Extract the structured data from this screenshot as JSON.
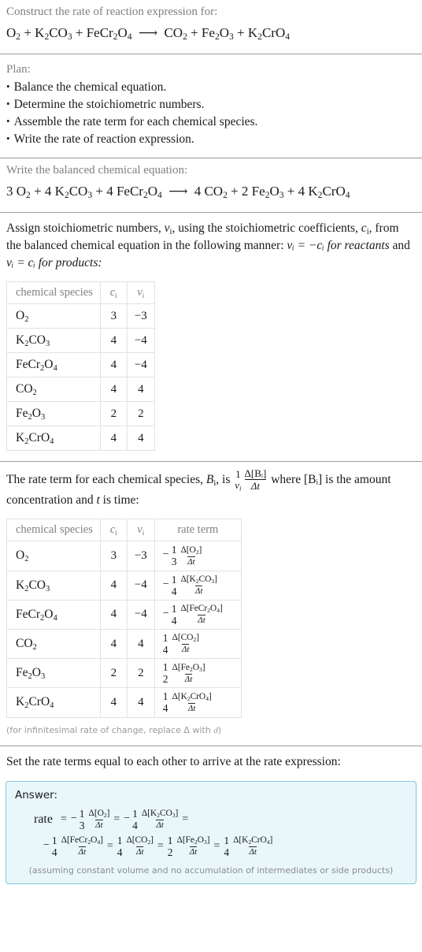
{
  "header": {
    "prompt": "Construct the rate of reaction expression for:",
    "equation": {
      "reactants": [
        {
          "formula": "O",
          "sub": "2"
        },
        {
          "formula": "K",
          "sub": "2",
          "formula2": "CO",
          "sub2": "3"
        },
        {
          "formula": "FeCr",
          "sub": "2",
          "formula2": "O",
          "sub2": "4"
        }
      ],
      "arrow": "⟶",
      "products": [
        {
          "formula": "CO",
          "sub": "2"
        },
        {
          "formula": "Fe",
          "sub": "2",
          "formula2": "O",
          "sub2": "3"
        },
        {
          "formula": "K",
          "sub": "2",
          "formula2": "CrO",
          "sub2": "4"
        }
      ]
    }
  },
  "plan": {
    "label": "Plan:",
    "steps": [
      "Balance the chemical equation.",
      "Determine the stoichiometric numbers.",
      "Assemble the rate term for each chemical species.",
      "Write the rate of reaction expression."
    ]
  },
  "balanced": {
    "label": "Write the balanced chemical equation:",
    "coefficients": {
      "O2": 3,
      "K2CO3": 4,
      "FeCr2O4": 4,
      "CO2": 4,
      "Fe2O3": 2,
      "K2CrO4": 4
    }
  },
  "assign": {
    "text_1": "Assign stoichiometric numbers, ",
    "nu_i": "ν",
    "text_2": ", using the stoichiometric coefficients, ",
    "c_i": "c",
    "text_3": ", from the balanced chemical equation in the following manner: ",
    "eq_reactants": "νᵢ = −cᵢ for reactants",
    "text_4": " and ",
    "eq_products": "νᵢ = cᵢ for products:"
  },
  "table_stoich": {
    "headers": [
      "chemical species",
      "c",
      "ν"
    ],
    "rows": [
      {
        "species": [
          {
            "t": "O"
          },
          {
            "s": "2"
          }
        ],
        "c": "3",
        "nu": "−3"
      },
      {
        "species": [
          {
            "t": "K"
          },
          {
            "s": "2"
          },
          {
            "t": "CO"
          },
          {
            "s": "3"
          }
        ],
        "c": "4",
        "nu": "−4"
      },
      {
        "species": [
          {
            "t": "FeCr"
          },
          {
            "s": "2"
          },
          {
            "t": "O"
          },
          {
            "s": "4"
          }
        ],
        "c": "4",
        "nu": "−4"
      },
      {
        "species": [
          {
            "t": "CO"
          },
          {
            "s": "2"
          }
        ],
        "c": "4",
        "nu": "4"
      },
      {
        "species": [
          {
            "t": "Fe"
          },
          {
            "s": "2"
          },
          {
            "t": "O"
          },
          {
            "s": "3"
          }
        ],
        "c": "2",
        "nu": "2"
      },
      {
        "species": [
          {
            "t": "K"
          },
          {
            "s": "2"
          },
          {
            "t": "CrO"
          },
          {
            "s": "4"
          }
        ],
        "c": "4",
        "nu": "4"
      }
    ]
  },
  "rateterm_intro": {
    "text_1": "The rate term for each chemical species, ",
    "B_i": "B",
    "text_2": ", is ",
    "frac_num": "1",
    "frac_den": "ν",
    "delta_num": "Δ[Bᵢ]",
    "delta_den": "Δt",
    "text_3": " where [Bᵢ] is the amount concentration and ",
    "t_italic": "t",
    "text_4": " is time:"
  },
  "table_rate": {
    "headers": [
      "chemical species",
      "c",
      "ν",
      "rate term"
    ],
    "rows": [
      {
        "species": [
          {
            "t": "O"
          },
          {
            "s": "2"
          }
        ],
        "c": "3",
        "nu": "−3",
        "sign": "−",
        "coef_num": "1",
        "coef_den": "3",
        "delta": [
          {
            "t": "Δ[O"
          },
          {
            "s": "2"
          },
          {
            "t": "]"
          }
        ],
        "dt": "Δt"
      },
      {
        "species": [
          {
            "t": "K"
          },
          {
            "s": "2"
          },
          {
            "t": "CO"
          },
          {
            "s": "3"
          }
        ],
        "c": "4",
        "nu": "−4",
        "sign": "−",
        "coef_num": "1",
        "coef_den": "4",
        "delta": [
          {
            "t": "Δ[K"
          },
          {
            "s": "2"
          },
          {
            "t": "CO"
          },
          {
            "s": "3"
          },
          {
            "t": "]"
          }
        ],
        "dt": "Δt"
      },
      {
        "species": [
          {
            "t": "FeCr"
          },
          {
            "s": "2"
          },
          {
            "t": "O"
          },
          {
            "s": "4"
          }
        ],
        "c": "4",
        "nu": "−4",
        "sign": "−",
        "coef_num": "1",
        "coef_den": "4",
        "delta": [
          {
            "t": "Δ[FeCr"
          },
          {
            "s": "2"
          },
          {
            "t": "O"
          },
          {
            "s": "4"
          },
          {
            "t": "]"
          }
        ],
        "dt": "Δt"
      },
      {
        "species": [
          {
            "t": "CO"
          },
          {
            "s": "2"
          }
        ],
        "c": "4",
        "nu": "4",
        "sign": "",
        "coef_num": "1",
        "coef_den": "4",
        "delta": [
          {
            "t": "Δ[CO"
          },
          {
            "s": "2"
          },
          {
            "t": "]"
          }
        ],
        "dt": "Δt"
      },
      {
        "species": [
          {
            "t": "Fe"
          },
          {
            "s": "2"
          },
          {
            "t": "O"
          },
          {
            "s": "3"
          }
        ],
        "c": "2",
        "nu": "2",
        "sign": "",
        "coef_num": "1",
        "coef_den": "2",
        "delta": [
          {
            "t": "Δ[Fe"
          },
          {
            "s": "2"
          },
          {
            "t": "O"
          },
          {
            "s": "3"
          },
          {
            "t": "]"
          }
        ],
        "dt": "Δt"
      },
      {
        "species": [
          {
            "t": "K"
          },
          {
            "s": "2"
          },
          {
            "t": "CrO"
          },
          {
            "s": "4"
          }
        ],
        "c": "4",
        "nu": "4",
        "sign": "",
        "coef_num": "1",
        "coef_den": "4",
        "delta": [
          {
            "t": "Δ[K"
          },
          {
            "s": "2"
          },
          {
            "t": "CrO"
          },
          {
            "s": "4"
          },
          {
            "t": "]"
          }
        ],
        "dt": "Δt"
      }
    ]
  },
  "infinitesimal_note": "(for infinitesimal rate of change, replace Δ with d)",
  "set_equal_label": "Set the rate terms equal to each other to arrive at the rate expression:",
  "answer": {
    "label": "Answer:",
    "rate_word": "rate",
    "equals": "=",
    "terms": [
      {
        "sign": "−",
        "num": "1",
        "den": "3",
        "delta": [
          {
            "t": "Δ[O"
          },
          {
            "s": "2"
          },
          {
            "t": "]"
          }
        ],
        "dt": "Δt"
      },
      {
        "sign": "−",
        "num": "1",
        "den": "4",
        "delta": [
          {
            "t": "Δ[K"
          },
          {
            "s": "2"
          },
          {
            "t": "CO"
          },
          {
            "s": "3"
          },
          {
            "t": "]"
          }
        ],
        "dt": "Δt"
      },
      {
        "sign": "−",
        "num": "1",
        "den": "4",
        "delta": [
          {
            "t": "Δ[FeCr"
          },
          {
            "s": "2"
          },
          {
            "t": "O"
          },
          {
            "s": "4"
          },
          {
            "t": "]"
          }
        ],
        "dt": "Δt"
      },
      {
        "sign": "",
        "num": "1",
        "den": "4",
        "delta": [
          {
            "t": "Δ[CO"
          },
          {
            "s": "2"
          },
          {
            "t": "]"
          }
        ],
        "dt": "Δt"
      },
      {
        "sign": "",
        "num": "1",
        "den": "2",
        "delta": [
          {
            "t": "Δ[Fe"
          },
          {
            "s": "2"
          },
          {
            "t": "O"
          },
          {
            "s": "3"
          },
          {
            "t": "]"
          }
        ],
        "dt": "Δt"
      },
      {
        "sign": "",
        "num": "1",
        "den": "4",
        "delta": [
          {
            "t": "Δ[K"
          },
          {
            "s": "2"
          },
          {
            "t": "CrO"
          },
          {
            "s": "4"
          },
          {
            "t": "]"
          }
        ],
        "dt": "Δt"
      }
    ],
    "note": "(assuming constant volume and no accumulation of intermediates or side products)"
  },
  "colors": {
    "answer_bg": "#e9f7fb",
    "answer_border": "#81c6de",
    "rule": "#9c9c9c",
    "table_border": "#e2e2e2",
    "muted_text": "#808080"
  }
}
